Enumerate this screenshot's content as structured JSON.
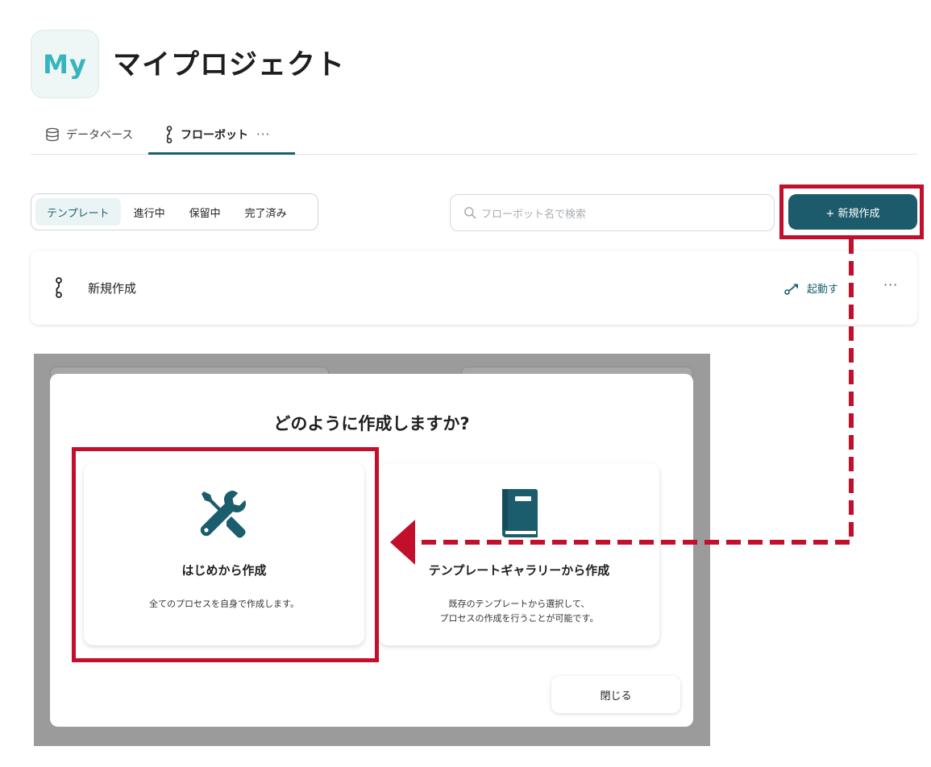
{
  "project": {
    "avatar_text": "My",
    "title": "マイプロジェクト"
  },
  "tabs": {
    "database": "データベース",
    "flowbot": "フローボット",
    "more": "···"
  },
  "filters": [
    "テンプレート",
    "進行中",
    "保留中",
    "完了済み"
  ],
  "search": {
    "placeholder": "フローボット名で検索"
  },
  "new_button": {
    "label": "+ 新規作成"
  },
  "flow_row": {
    "name": "新規作成",
    "launch": "起動す",
    "more": "···"
  },
  "modal": {
    "title": "どのように作成しますか?",
    "options": [
      {
        "icon": "wrench-screwdriver-icon",
        "title": "はじめから作成",
        "desc_line1": "全てのプロセスを自身で作成します。",
        "desc_line2": ""
      },
      {
        "icon": "book-icon",
        "title": "テンプレートギャラリーから作成",
        "desc_line1": "既存のテンプレートから選択して、",
        "desc_line2": "プロセスの作成を行うことが可能です。"
      }
    ],
    "close_label": "閉じる"
  },
  "colors": {
    "accent": "#1c5b6b",
    "highlight": "#c20f2b",
    "avatar_text": "#36b5bd"
  }
}
